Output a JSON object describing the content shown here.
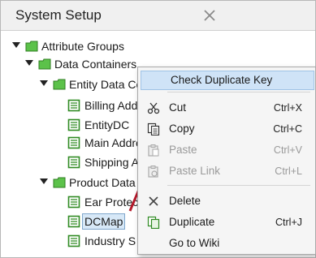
{
  "panel": {
    "title": "System Setup"
  },
  "tree": {
    "attribute_groups": "Attribute Groups",
    "data_containers": "Data Containers",
    "entity_data_containers": "Entity Data Co",
    "billing": "Billing Addr",
    "entitydc": "EntityDC",
    "main_address": "Main Addre",
    "shipping": "Shipping A",
    "product_data": "Product Data",
    "ear_protection": "Ear Protec",
    "dcmap": "DCMap",
    "industry": "Industry S"
  },
  "context_menu": {
    "check_duplicate_key": "Check Duplicate Key",
    "cut": {
      "label": "Cut",
      "shortcut": "Ctrl+X"
    },
    "copy": {
      "label": "Copy",
      "shortcut": "Ctrl+C"
    },
    "paste": {
      "label": "Paste",
      "shortcut": "Ctrl+V"
    },
    "paste_link": {
      "label": "Paste Link",
      "shortcut": "Ctrl+L"
    },
    "delete": {
      "label": "Delete"
    },
    "duplicate": {
      "label": "Duplicate",
      "shortcut": "Ctrl+J"
    },
    "go_to_wiki": {
      "label": "Go to Wiki"
    }
  },
  "colors": {
    "folder_green": "#4caf3a",
    "highlight": "#cfe3f7",
    "arrow_red": "#b5192b"
  }
}
